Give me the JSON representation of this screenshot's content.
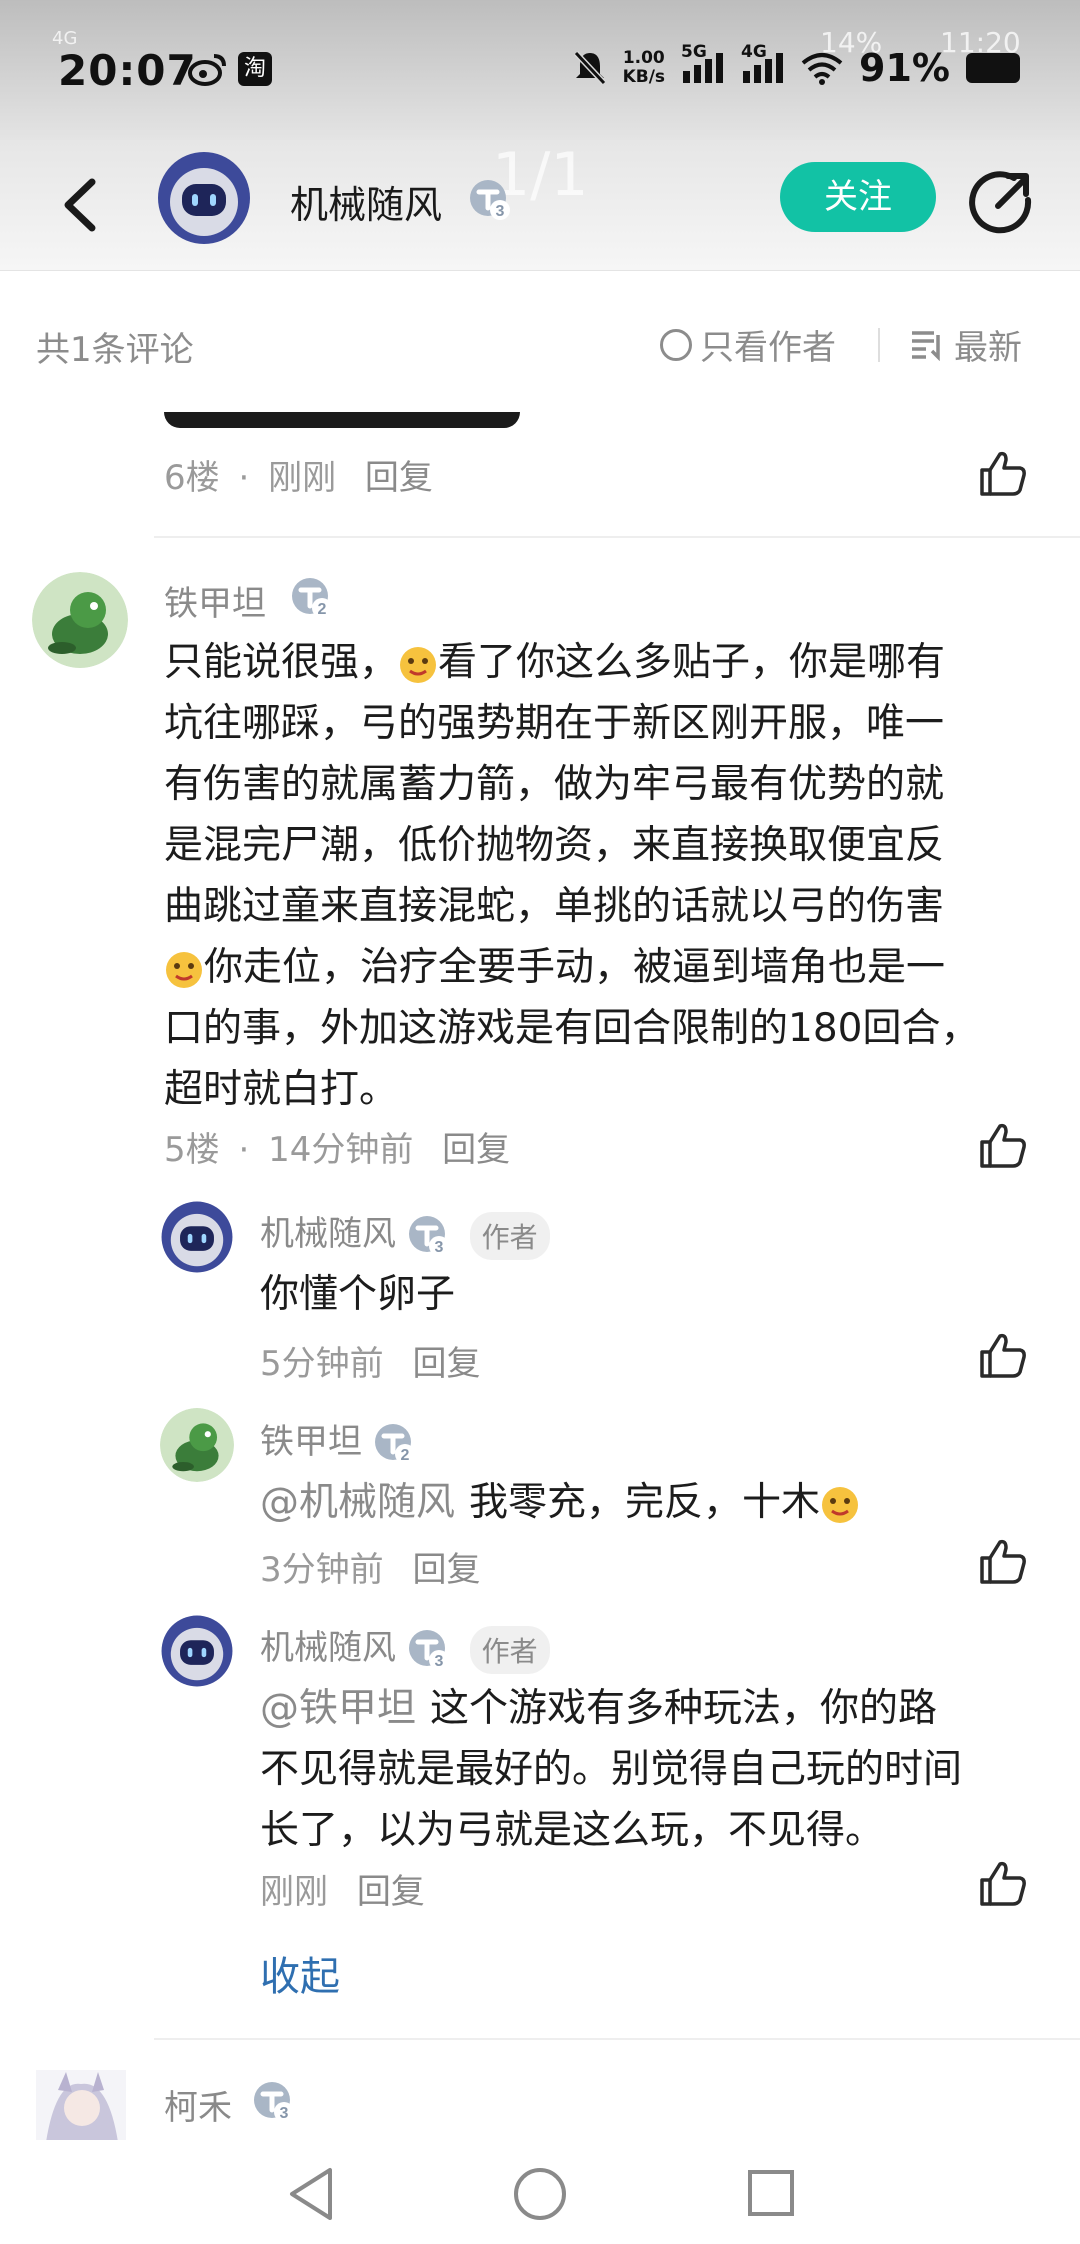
{
  "status_bar": {
    "time": "20:07",
    "ghost_time": "11:20",
    "ghost_battery": "14%",
    "ghost_page": "1/1",
    "network_speed_value": "1.00",
    "network_speed_unit": "KB/s",
    "network_5g": "5G",
    "network_4g": "4G",
    "signal_4g": "4G",
    "battery_pct": "91%",
    "taobao_icon": "淘"
  },
  "header": {
    "username": "机械随风",
    "level": "3",
    "follow_label": "关注"
  },
  "comment_bar": {
    "count_label": "共1条评论",
    "author_only_label": "只看作者",
    "sort_label": "最新"
  },
  "floor6": {
    "floor": "6楼",
    "time": "刚刚",
    "reply": "回复"
  },
  "floor5": {
    "username": "铁甲坦",
    "level": "2",
    "lines": [
      [
        "只能说很强，",
        "😜",
        "看了你这么多贴子，你是哪有"
      ],
      [
        "坑往哪踩，弓的强势期在于新区刚开服，唯一"
      ],
      [
        "有伤害的就属蓄力箭，做为牢弓最有优势的就"
      ],
      [
        "是混完尸潮，低价抛物资，来直接换取便宜反"
      ],
      [
        "曲跳过童来直接混蛇，单挑的话就以弓的伤害"
      ],
      [
        "😜",
        "你走位，治疗全要手动，被逼到墙角也是一"
      ],
      [
        "口的事，外加这游戏是有回合限制的180回合，"
      ],
      [
        "超时就白打。"
      ]
    ],
    "floor": "5楼",
    "dot": "·",
    "time": "14分钟前",
    "reply": "回复"
  },
  "replies": [
    {
      "username": "机械随风",
      "level": "3",
      "author_tag": "作者",
      "mention": "",
      "lines": [
        "你懂个卵子"
      ],
      "time": "5分钟前",
      "reply": "回复"
    },
    {
      "username": "铁甲坦",
      "level": "2",
      "author_tag": "",
      "mention": "@机械随风",
      "lines": [
        "我零充，完反，十木"
      ],
      "time": "3分钟前",
      "reply": "回复"
    },
    {
      "username": "机械随风",
      "level": "3",
      "author_tag": "作者",
      "mention": "@铁甲坦",
      "lines": [
        "这个游戏有多种玩法，你的路",
        "不见得就是最好的。别觉得自己玩的时间",
        "长了，以为弓就是这么玩，不见得。"
      ],
      "time": "刚刚",
      "reply": "回复"
    }
  ],
  "collapse_label": "收起",
  "next_comment": {
    "username": "柯禾",
    "level": "3"
  },
  "colors": {
    "accent": "#12c2a5",
    "link": "#2f6fb0",
    "meta": "#9a9a9a"
  },
  "icons": [
    "back-arrow-icon",
    "share-icon",
    "circle-icon",
    "sort-list-icon",
    "thumbs-up-icon",
    "nav-back-icon",
    "nav-home-icon",
    "nav-recents-icon"
  ]
}
